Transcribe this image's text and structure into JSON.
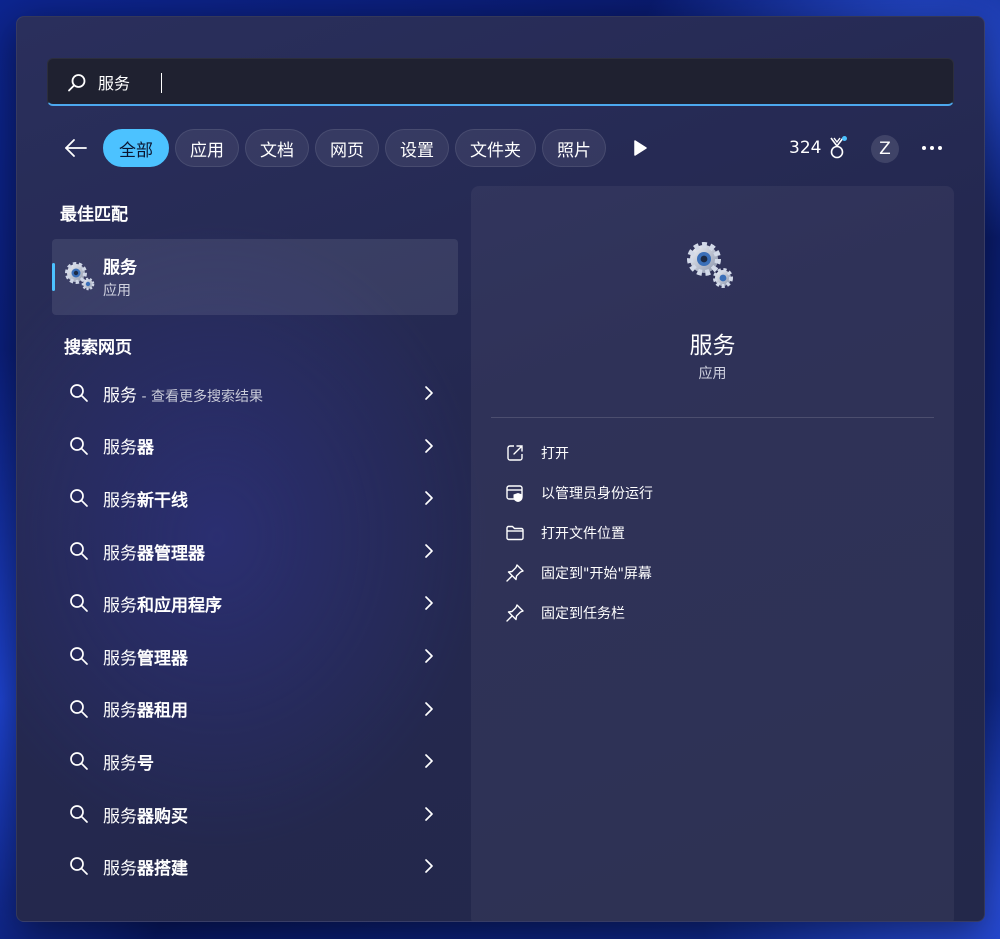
{
  "search": {
    "query": "服务",
    "icon": "search-icon"
  },
  "filters": {
    "back_icon": "arrow-left-icon",
    "chips": [
      {
        "label": "全部",
        "active": true
      },
      {
        "label": "应用",
        "active": false
      },
      {
        "label": "文档",
        "active": false
      },
      {
        "label": "网页",
        "active": false
      },
      {
        "label": "设置",
        "active": false
      },
      {
        "label": "文件夹",
        "active": false
      },
      {
        "label": "照片",
        "active": false
      }
    ],
    "play_icon": "play-icon",
    "points": "324",
    "medal_icon": "medal-icon",
    "avatar_initial": "Z",
    "more_icon": "more-icon"
  },
  "left": {
    "best_match_title": "最佳匹配",
    "best_match": {
      "name": "服务",
      "type": "应用",
      "icon": "gear-icon"
    },
    "web_title": "搜索网页",
    "results": [
      {
        "prefix": "服务",
        "suffix": "",
        "hint": " - 查看更多搜索结果"
      },
      {
        "prefix": "服务",
        "suffix": "器",
        "hint": ""
      },
      {
        "prefix": "服务",
        "suffix": "新干线",
        "hint": ""
      },
      {
        "prefix": "服务",
        "suffix": "器管理器",
        "hint": ""
      },
      {
        "prefix": "服务",
        "suffix": "和应用程序",
        "hint": ""
      },
      {
        "prefix": "服务",
        "suffix": "管理器",
        "hint": ""
      },
      {
        "prefix": "服务",
        "suffix": "器租用",
        "hint": ""
      },
      {
        "prefix": "服务",
        "suffix": "号",
        "hint": ""
      },
      {
        "prefix": "服务",
        "suffix": "器购买",
        "hint": ""
      },
      {
        "prefix": "服务",
        "suffix": "器搭建",
        "hint": ""
      }
    ]
  },
  "detail": {
    "name": "服务",
    "type": "应用",
    "actions": [
      {
        "label": "打开",
        "icon": "open-external-icon"
      },
      {
        "label": "以管理员身份运行",
        "icon": "shield-admin-icon"
      },
      {
        "label": "打开文件位置",
        "icon": "folder-icon"
      },
      {
        "label": "固定到\"开始\"屏幕",
        "icon": "pin-icon"
      },
      {
        "label": "固定到任务栏",
        "icon": "pin-icon"
      }
    ]
  },
  "colors": {
    "accent": "#4cc2ff",
    "search_underline": "#4ca8ee"
  }
}
